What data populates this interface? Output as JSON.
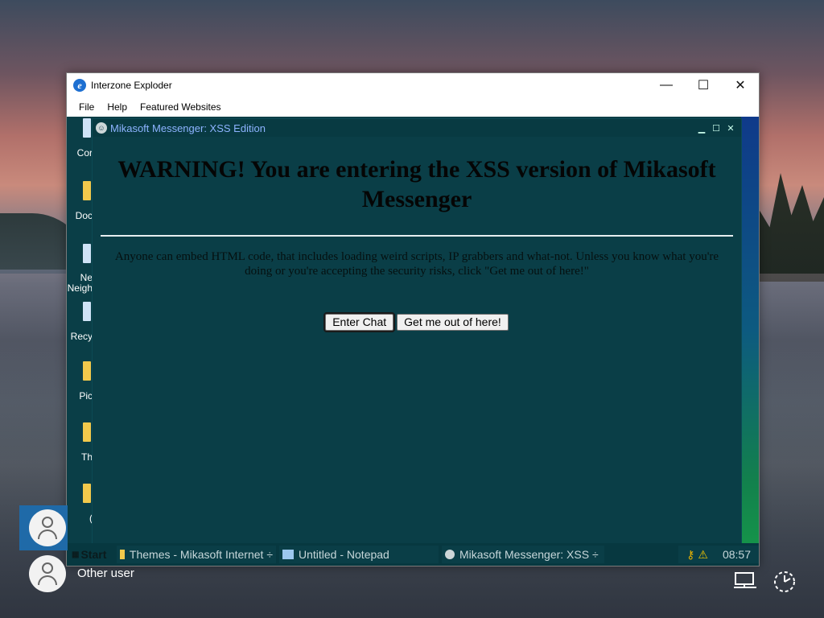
{
  "browser": {
    "title": "Interzone Exploder",
    "menu": [
      "File",
      "Help",
      "Featured Websites"
    ],
    "controls": {
      "minimize": "—",
      "maximize": "☐",
      "close": "✕"
    }
  },
  "desktop_icons": [
    {
      "label": "Cor",
      "icon": "computer-icon"
    },
    {
      "label": "Doc",
      "icon": "folder-icon"
    },
    {
      "label": "Ne\nNeigh",
      "icon": "network-icon"
    },
    {
      "label": "Recy",
      "icon": "recycle-bin-icon"
    },
    {
      "label": "Pic",
      "icon": "folder-icon"
    },
    {
      "label": "Th",
      "icon": "folder-icon"
    },
    {
      "label": "(",
      "icon": "folder-icon"
    }
  ],
  "messenger": {
    "title": "Mikasoft Messenger: XSS Edition",
    "heading": "WARNING! You are entering the XSS version of Mikasoft Messenger",
    "body": "Anyone can embed HTML code, that includes loading weird scripts, IP grabbers and what-not. Unless you know what you're doing or you're accepting the security risks, click \"Get me out of here!\"",
    "enter_button": "Enter Chat",
    "exit_button": "Get me out of here!"
  },
  "taskbar": {
    "start_label": "Start",
    "tasks": [
      "Themes - Mikasoft Internet ÷",
      "Untitled - Notepad",
      "Mikasoft Messenger: XSS ÷"
    ],
    "clock": "08:57"
  },
  "login": {
    "other_user_label": "Other user"
  }
}
